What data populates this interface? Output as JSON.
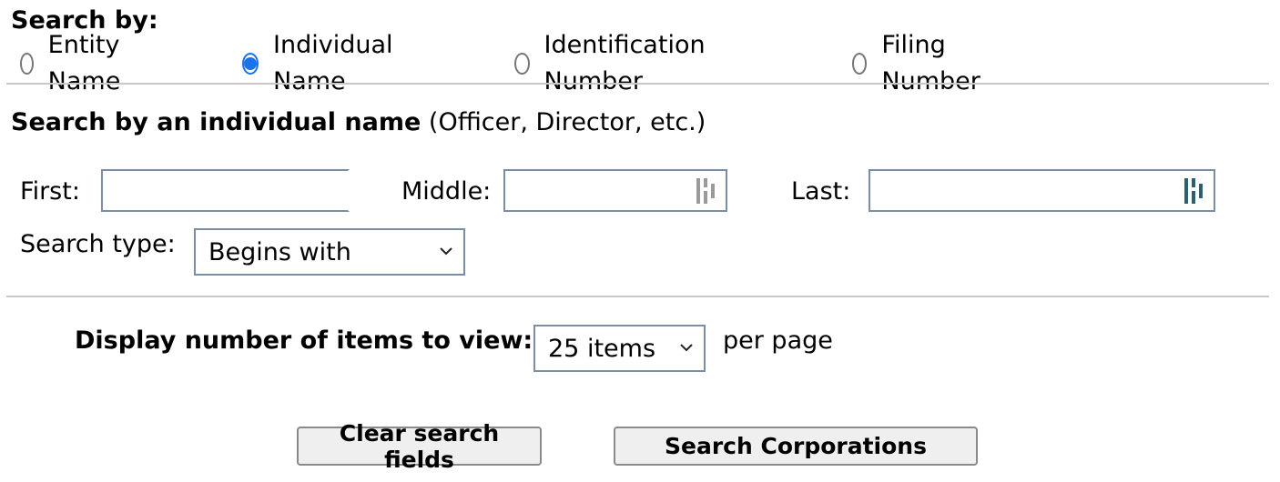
{
  "search_by": {
    "title": "Search by:",
    "options": [
      {
        "label": "Entity Name",
        "checked": false
      },
      {
        "label": "Individual Name",
        "checked": true
      },
      {
        "label": "Identification Number",
        "checked": false
      },
      {
        "label": "Filing Number",
        "checked": false
      }
    ]
  },
  "individual": {
    "title": "Search by an individual name",
    "note": "(Officer, Director, etc.)",
    "first_label": "First:",
    "first_value": "",
    "middle_label": "Middle:",
    "middle_value": "",
    "last_label": "Last:",
    "last_value": "",
    "search_type_label": "Search type:",
    "search_type_value": "Begins with"
  },
  "display": {
    "label": "Display number of items to view:",
    "value": "25 items",
    "suffix": "per page"
  },
  "buttons": {
    "clear": "Clear search fields",
    "search": "Search Corporations"
  },
  "colors": {
    "radio_checked": "#1a73e8",
    "input_border": "#7a8fa6",
    "divider": "#c8c8c8",
    "button_bg": "#efefef"
  },
  "icons": {
    "password_manager": "password-manager-icon",
    "chevron": "chevron-down-icon"
  }
}
